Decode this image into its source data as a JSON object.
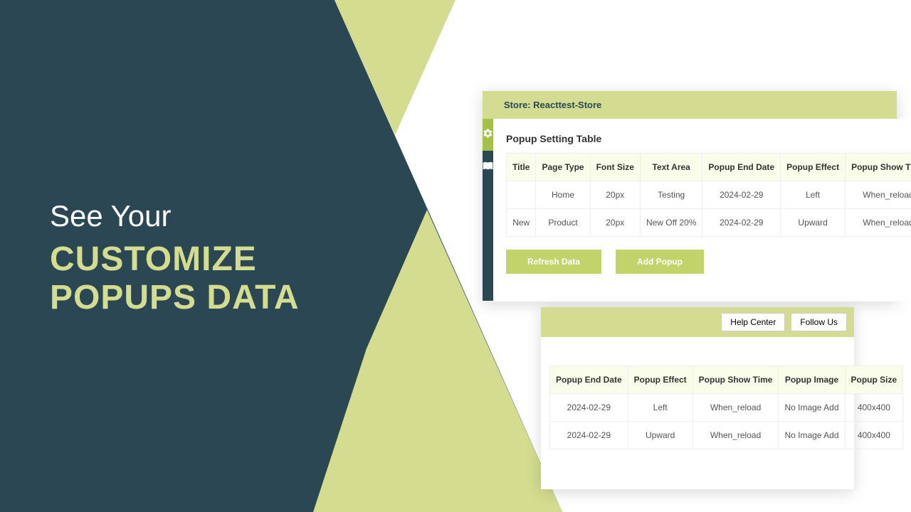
{
  "hero": {
    "line1": "See Your",
    "line2": "CUSTOMIZE",
    "line3": "POPUPS DATA"
  },
  "panel1": {
    "store_label": "Store: Reacttest-Store",
    "section_title": "Popup Setting Table",
    "headers": {
      "title": "Title",
      "page_type": "Page Type",
      "font_size": "Font Size",
      "text_area": "Text Area",
      "popup_end_date": "Popup End Date",
      "popup_effect": "Popup Effect",
      "popup_show_time": "Popup Show Time"
    },
    "rows": [
      {
        "title": "",
        "page_type": "Home",
        "font_size": "20px",
        "text_area": "Testing",
        "popup_end_date": "2024-02-29",
        "popup_effect": "Left",
        "popup_show_time": "When_reload"
      },
      {
        "title": "New",
        "page_type": "Product",
        "font_size": "20px",
        "text_area": "New Off 20%",
        "popup_end_date": "2024-02-29",
        "popup_effect": "Upward",
        "popup_show_time": "When_reload"
      }
    ],
    "buttons": {
      "refresh": "Refresh Data",
      "add": "Add Popup"
    }
  },
  "panel2": {
    "buttons": {
      "help": "Help Center",
      "follow": "Follow Us"
    },
    "headers": {
      "popup_end_date": "Popup End Date",
      "popup_effect": "Popup Effect",
      "popup_show_time": "Popup Show Time",
      "popup_image": "Popup Image",
      "popup_size": "Popup Size"
    },
    "rows": [
      {
        "popup_end_date": "2024-02-29",
        "popup_effect": "Left",
        "popup_show_time": "When_reload",
        "popup_image": "No Image Add",
        "popup_size": "400x400"
      },
      {
        "popup_end_date": "2024-02-29",
        "popup_effect": "Upward",
        "popup_show_time": "When_reload",
        "popup_image": "No Image Add",
        "popup_size": "400x400"
      }
    ]
  }
}
